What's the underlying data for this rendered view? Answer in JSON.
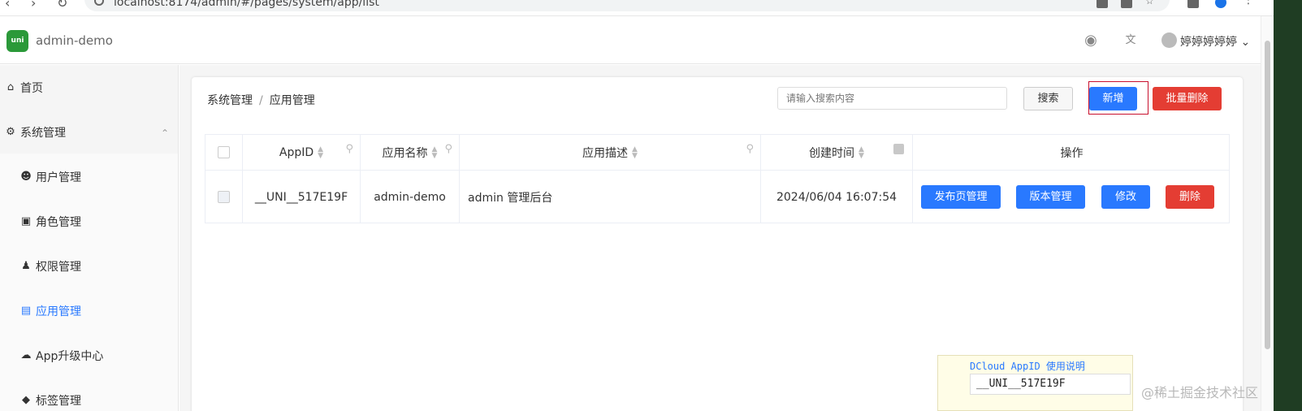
{
  "browser": {
    "url": "localhost:8174/admin/#/pages/system/app/list"
  },
  "header": {
    "app_title": "admin-demo",
    "logo_text": "uni",
    "user_name": "婷婷婷婷婷",
    "accent": "#2979ff"
  },
  "sidebar": {
    "items": [
      {
        "label": "首页",
        "icon": "home-icon"
      },
      {
        "label": "系统管理",
        "icon": "gear-icon"
      },
      {
        "label": "用户管理",
        "icon": "user-gear-icon"
      },
      {
        "label": "角色管理",
        "icon": "role-icon"
      },
      {
        "label": "权限管理",
        "icon": "permission-icon"
      },
      {
        "label": "应用管理",
        "icon": "app-icon",
        "active": true
      },
      {
        "label": "App升级中心",
        "icon": "cloud-upload-icon"
      },
      {
        "label": "标签管理",
        "icon": "tag-icon"
      }
    ]
  },
  "breadcrumb": {
    "parent": "系统管理",
    "separator": "/",
    "current": "应用管理"
  },
  "toolbar": {
    "search_placeholder": "请输入搜索内容",
    "search_label": "搜索",
    "add_label": "新增",
    "batch_delete_label": "批量删除"
  },
  "table": {
    "columns": [
      "AppID",
      "应用名称",
      "应用描述",
      "创建时间",
      "操作"
    ],
    "rows": [
      {
        "appid": "__UNI__517E19F",
        "name": "admin-demo",
        "desc": "admin 管理后台",
        "created": "2024/06/04 16:07:54",
        "actions": [
          "发布页管理",
          "版本管理",
          "修改",
          "删除"
        ]
      }
    ]
  },
  "tooltip": {
    "link": "DCloud AppID 使用说明",
    "code": "__UNI__517E19F"
  },
  "watermark": "@稀土掘金技术社区",
  "colors": {
    "primary": "#2979ff",
    "danger": "#e43d33",
    "logo_green": "#2b9939"
  }
}
